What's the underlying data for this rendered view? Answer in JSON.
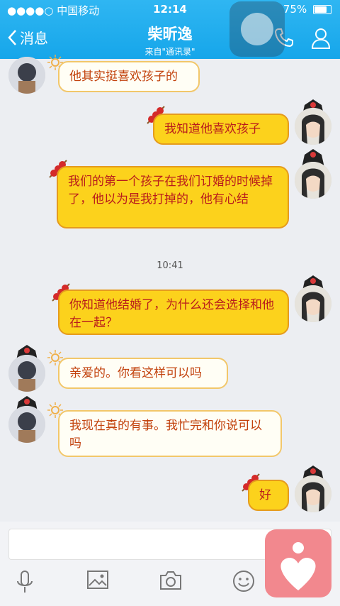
{
  "status_bar": {
    "carrier": "●●●●○ 中国移动",
    "time": "12:14",
    "battery": "75%",
    "battery_level": 0.75
  },
  "header": {
    "back_label": "消息",
    "contact_name": "柴昕逸",
    "source": "来自\"通讯录\""
  },
  "messages": [
    {
      "dir": "in",
      "text": "他其实挺喜欢孩子的"
    },
    {
      "dir": "out",
      "text": "我知道他喜欢孩子"
    },
    {
      "dir": "out",
      "text": "我们的第一个孩子在我们订婚的时候掉了，他以为是我打掉的，他有心结"
    },
    {
      "dir": "out",
      "text": "你知道他结婚了，为什么还会选择和他在一起？"
    },
    {
      "dir": "in",
      "text": "亲爱的。你看这样可以吗"
    },
    {
      "dir": "in",
      "text": "我现在真的有事。我忙完和你说可以吗"
    },
    {
      "dir": "out",
      "text": "好"
    }
  ],
  "timestamp": "10:41",
  "toolbar": {
    "icons": [
      "mic-icon",
      "image-icon",
      "camera-icon",
      "emoji-icon"
    ]
  },
  "colors": {
    "header": "#16a6ea",
    "out_bubble": "#fcd21c",
    "in_bubble": "#fffef5",
    "heart_widget": "#f2888e"
  }
}
